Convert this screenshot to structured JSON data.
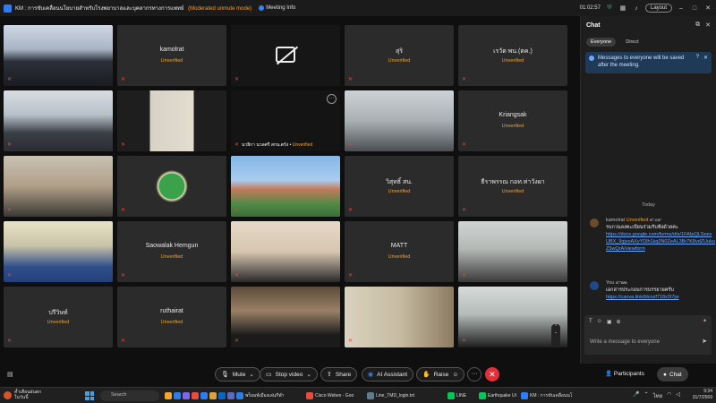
{
  "window": {
    "title": "KM : การขับเคลื่อนนโยบายสำหรับโรงพยาบาลและบุคลากรทางการแพทย์",
    "mode": "(Moderated unmute mode)",
    "meeting_info": "Meeting Info",
    "timer": "01:02:57",
    "layout_label": "Layout"
  },
  "tiles": [
    {
      "kind": "video",
      "scene": "room"
    },
    {
      "kind": "name",
      "name": "kamolrat",
      "status": "Unverified"
    },
    {
      "kind": "camoff"
    },
    {
      "kind": "name",
      "name": "สุริ",
      "status": "Unverified"
    },
    {
      "kind": "name",
      "name": "เรวัต พน.(ตค.)",
      "status": "Unverified"
    },
    {
      "kind": "video",
      "scene": "office2"
    },
    {
      "kind": "video",
      "scene": "woman"
    },
    {
      "kind": "self",
      "name": "นายิกา นวลศรี สกน.ตรัง",
      "status": "Unverified"
    },
    {
      "kind": "video",
      "scene": "office"
    },
    {
      "kind": "name",
      "name": "Kriangsak",
      "status": "Unverified"
    },
    {
      "kind": "video",
      "scene": "man"
    },
    {
      "kind": "video",
      "scene": "logo"
    },
    {
      "kind": "video",
      "scene": "building"
    },
    {
      "kind": "name",
      "name": "วิสุทธิ์ สน.",
      "status": "Unverified"
    },
    {
      "kind": "name",
      "name": "ธีราพรรณ กอท.ท่าวังผา",
      "status": "Unverified"
    },
    {
      "kind": "video",
      "scene": "man2"
    },
    {
      "kind": "name",
      "name": "Saowalak Hemgun",
      "status": "Unverified"
    },
    {
      "kind": "video",
      "scene": "woman2"
    },
    {
      "kind": "name",
      "name": "MATT",
      "status": "Unverified"
    },
    {
      "kind": "video",
      "scene": "man3"
    },
    {
      "kind": "name",
      "name": "ปรีวิษท์",
      "status": "Unverified"
    },
    {
      "kind": "name",
      "name": "ruthairat",
      "status": "Unverified"
    },
    {
      "kind": "video",
      "scene": "mardi"
    },
    {
      "kind": "video",
      "scene": "room2"
    },
    {
      "kind": "video",
      "scene": "woman3"
    }
  ],
  "chat": {
    "title": "Chat",
    "tabs": [
      "Everyone",
      "Direct"
    ],
    "notice": "Messages to everyone will be saved after the meeting.",
    "today": "Today",
    "messages": [
      {
        "sender": "kamolrat",
        "status": "Unverified",
        "time": "๙:๐๙",
        "text": "รบกวนลงทะเบียนร่วมรับฟังด้วยค่ะ",
        "link": "https://docs.google.com/forms/d/e/1FAIpQLSeesUBX_9qjvoAXyYDlh1kq3N0ZeAL3Br7K8vdZUukuZ5wQrA/viewform"
      },
      {
        "sender": "You",
        "time": "๙:๒๒",
        "text": "เอกสารประกอบการบรรยายครับ",
        "link": "https://canva.link/blcnzf718x2t7jw"
      }
    ],
    "composer_placeholder": "Write a message to everyone"
  },
  "controls": {
    "mute": "Mute",
    "stop_video": "Stop video",
    "share": "Share",
    "ai_assistant": "AI Assistant",
    "raise": "Raise",
    "participants": "Participants",
    "chat": "Chat"
  },
  "taskbar": {
    "weather_line1": "ค้ำเตือนฝนตก",
    "weather_line2": "ในวันนี้",
    "search": "Search",
    "apps": [
      {
        "label": "พร็อมพ์เมืองเล่นกีฬา",
        "color": "#2b7de9"
      },
      {
        "label": "Cisco Webex - Goo",
        "color": "#e94b3c"
      },
      {
        "label": "Line_TMD_login.txt",
        "color": "#607d8b"
      },
      {
        "label": "LINE",
        "color": "#06c755"
      },
      {
        "label": "Earthquake UI",
        "color": "#06c755"
      },
      {
        "label": "KM : การขับเคลื่อนนโ",
        "color": "#2f7df6"
      }
    ],
    "lang": "ไทย",
    "time": "9:34",
    "date": "31/7/2569"
  },
  "colors": {
    "accent": "#2f7df6",
    "unverified": "#e8a33c",
    "end": "#e0303a",
    "link": "#6aa8ff"
  }
}
